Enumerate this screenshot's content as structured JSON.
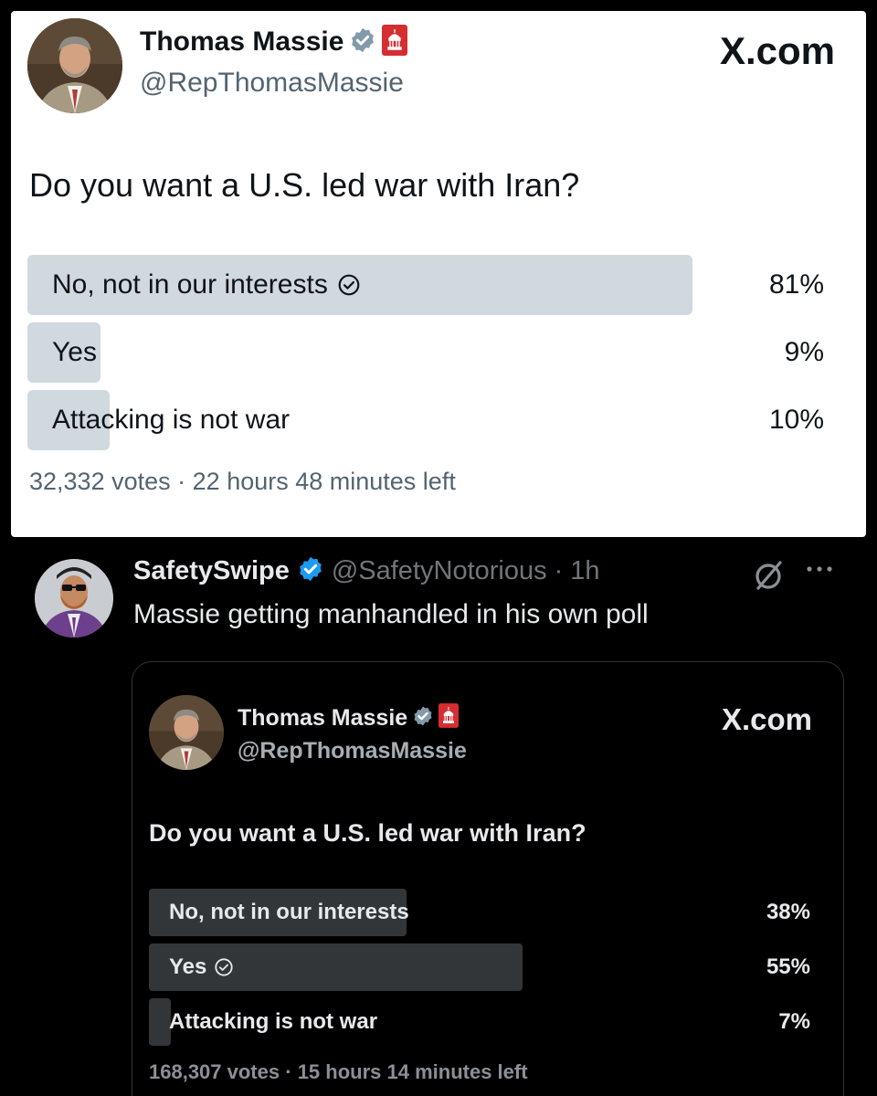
{
  "top_card": {
    "author_name": "Thomas Massie",
    "author_handle": "@RepThomasMassie",
    "brand": "X.com",
    "question": "Do you want a U.S. led war with Iran?",
    "options": [
      {
        "label": "No, not in our interests",
        "percent_text": "81%",
        "share": 0.81,
        "selected": true
      },
      {
        "label": "Yes",
        "percent_text": "9%",
        "share": 0.09,
        "selected": false
      },
      {
        "label": "Attacking is not war",
        "percent_text": "10%",
        "share": 0.1,
        "selected": false
      }
    ],
    "votes_text": "32,332 votes",
    "time_left_text": "22 hours 48 minutes left",
    "colors": {
      "bar": "#cfd9de",
      "verified_badge": "#829aab",
      "government_badge": "#d62d31"
    }
  },
  "tweet": {
    "author_name": "SafetySwipe",
    "author_handle": "@SafetyNotorious",
    "time": "1h",
    "text": "Massie getting manhandled in his own poll",
    "icons": [
      "grok-icon",
      "more-icon"
    ],
    "colors": {
      "verified_badge": "#1d9bf0"
    }
  },
  "quoted_card": {
    "author_name": "Thomas Massie",
    "author_handle": "@RepThomasMassie",
    "brand": "X.com",
    "question": "Do you want a U.S. led war with Iran?",
    "options": [
      {
        "label": "No, not in our interests",
        "percent_text": "38%",
        "share": 0.38,
        "selected": false
      },
      {
        "label": "Yes",
        "percent_text": "55%",
        "share": 0.55,
        "selected": true
      },
      {
        "label": "Attacking is not war",
        "percent_text": "7%",
        "share": 0.07,
        "selected": false
      }
    ],
    "votes_text": "168,307 votes",
    "time_left_text": "15 hours 14 minutes left",
    "colors": {
      "bar": "#333639"
    }
  },
  "separator": "·"
}
